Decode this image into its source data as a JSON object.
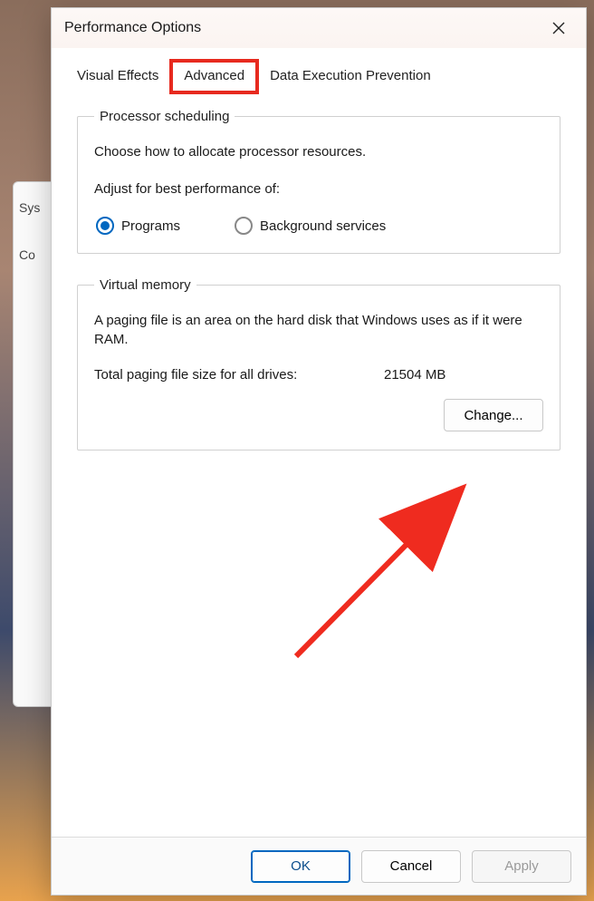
{
  "dialog": {
    "title": "Performance Options",
    "close_aria": "Close"
  },
  "tabs": {
    "visual_effects": "Visual Effects",
    "advanced": "Advanced",
    "dep": "Data Execution Prevention"
  },
  "processor": {
    "legend": "Processor scheduling",
    "desc": "Choose how to allocate processor resources.",
    "adjust_label": "Adjust for best performance of:",
    "programs": "Programs",
    "background": "Background services"
  },
  "virtualmem": {
    "legend": "Virtual memory",
    "desc": "A paging file is an area on the hard disk that Windows uses as if it were RAM.",
    "total_label": "Total paging file size for all drives:",
    "total_value": "21504 MB",
    "change_btn": "Change..."
  },
  "footer": {
    "ok": "OK",
    "cancel": "Cancel",
    "apply": "Apply"
  },
  "bg": {
    "line1": "Sys",
    "line2": "Co"
  }
}
